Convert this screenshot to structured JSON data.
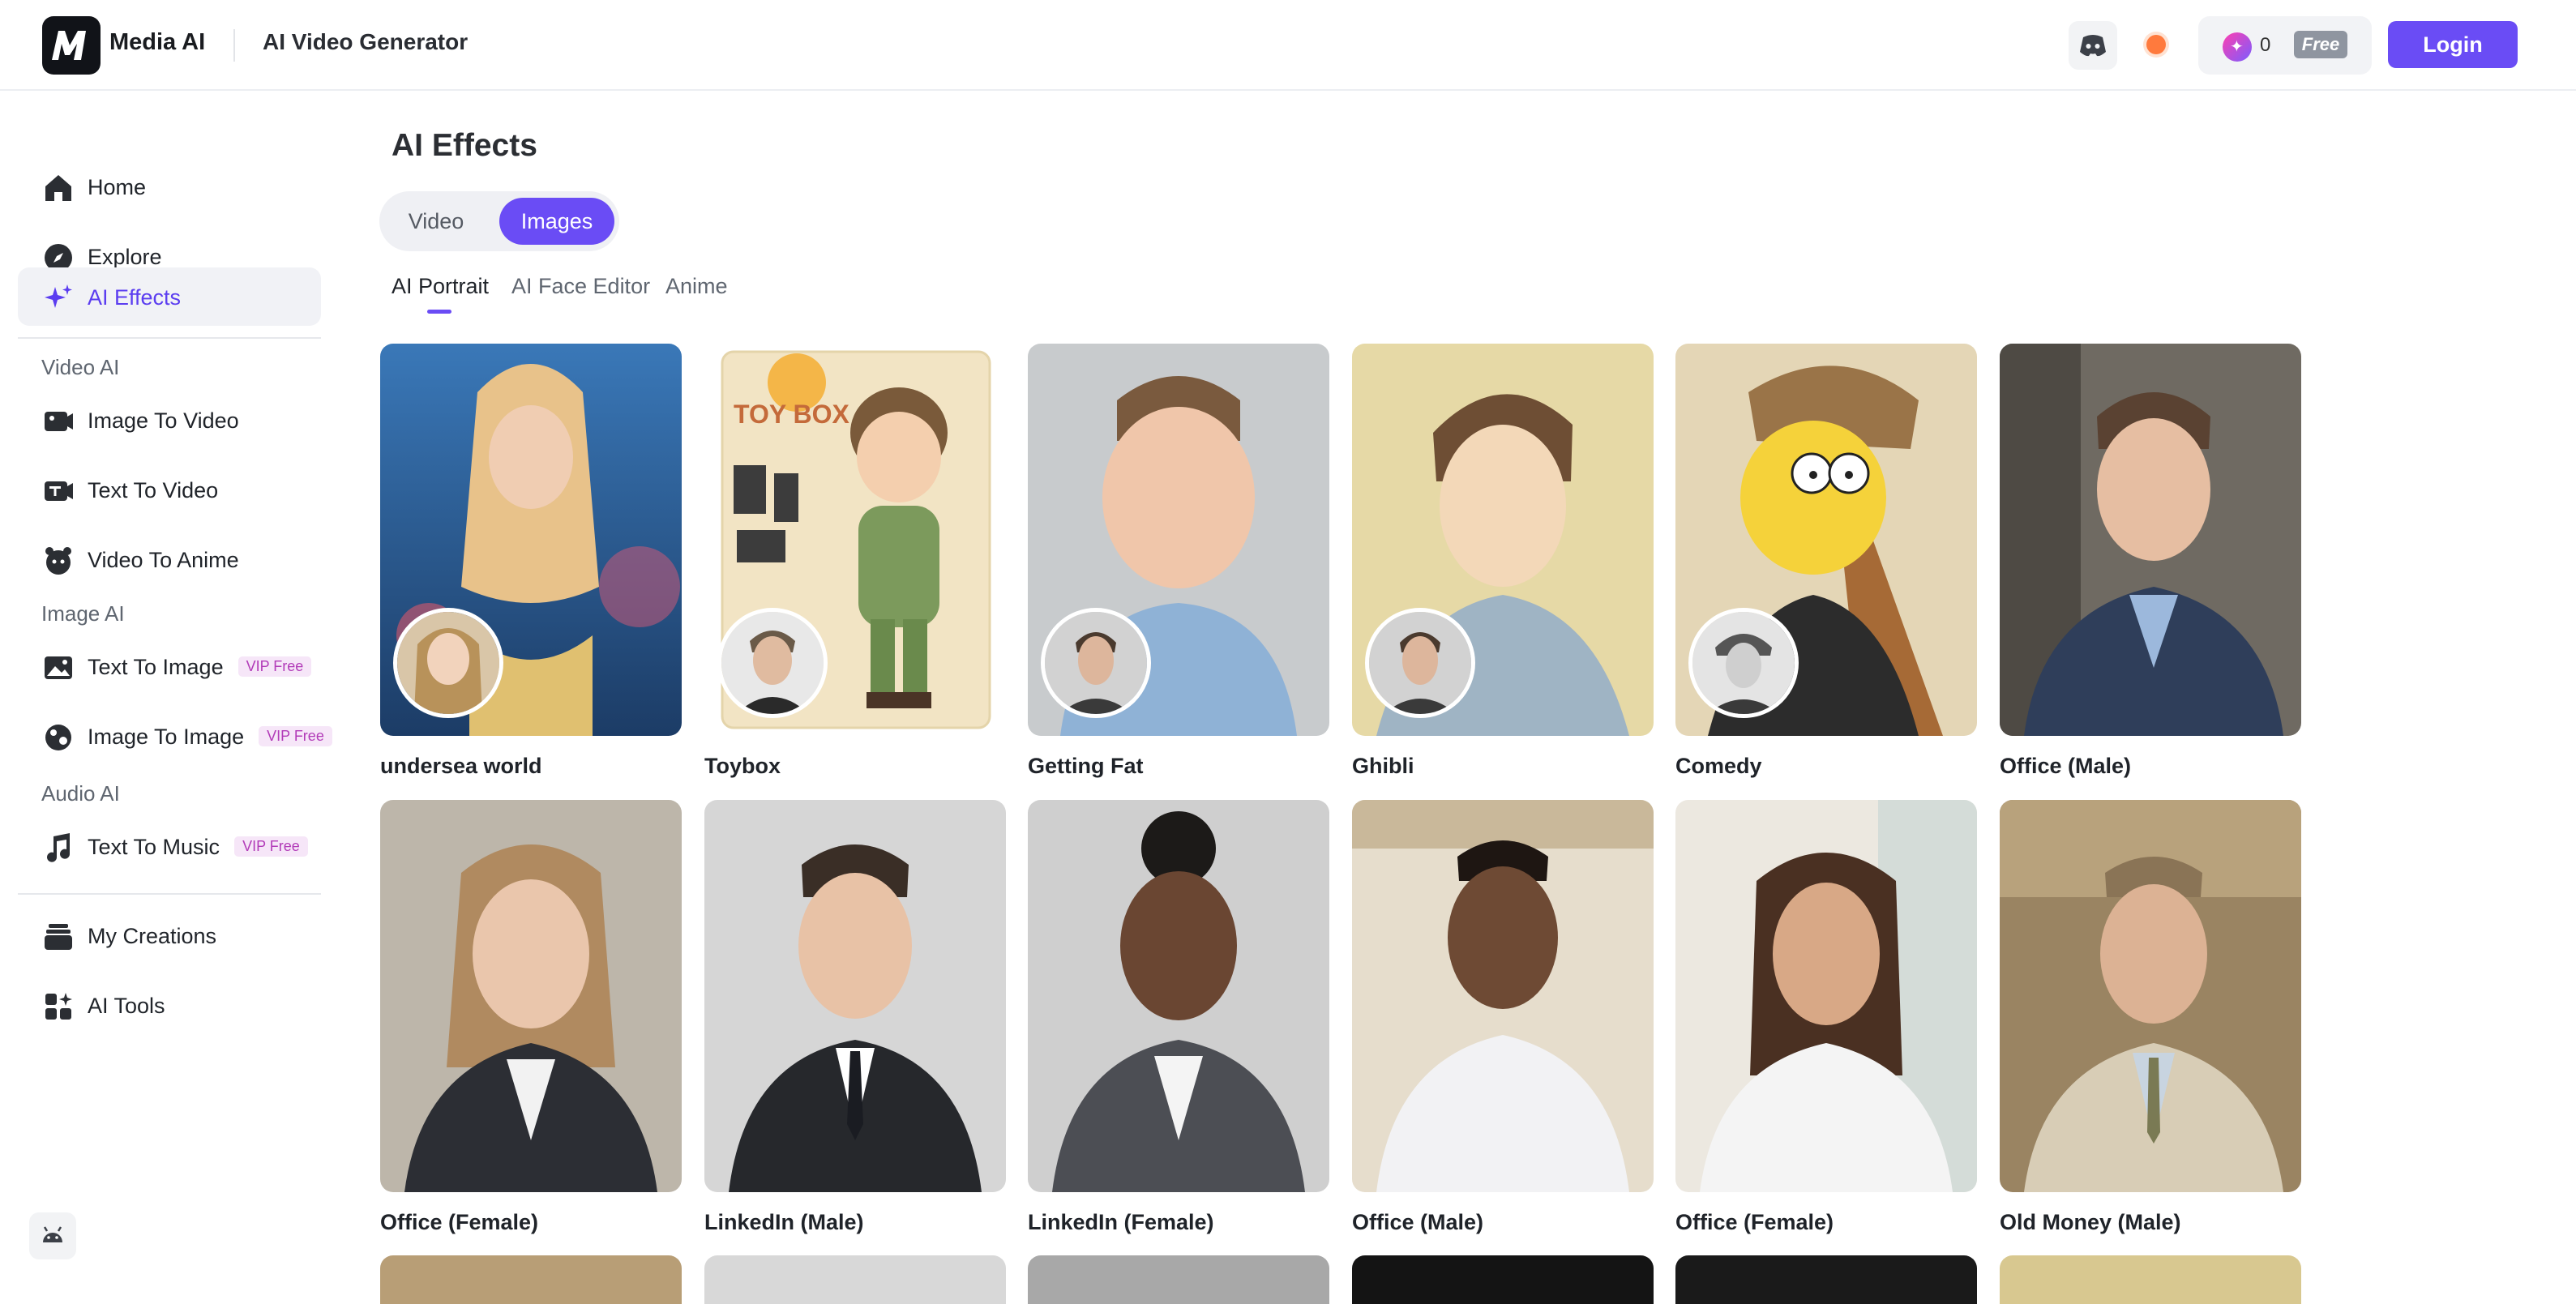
{
  "header": {
    "brand": "Media AI",
    "title": "AI Video Generator",
    "credits": "0",
    "plan_badge": "Free",
    "login_label": "Login"
  },
  "sidebar": {
    "top_items": [
      {
        "label": "Home",
        "icon": "home-icon"
      },
      {
        "label": "Explore",
        "icon": "compass-icon"
      },
      {
        "label": "AI Effects",
        "icon": "sparkle-icon",
        "active": true
      }
    ],
    "sections": [
      {
        "title": "Video AI",
        "items": [
          {
            "label": "Image To Video",
            "icon": "image-video-icon"
          },
          {
            "label": "Text To Video",
            "icon": "text-video-icon"
          },
          {
            "label": "Video To Anime",
            "icon": "anime-icon"
          }
        ]
      },
      {
        "title": "Image AI",
        "items": [
          {
            "label": "Text To Image",
            "icon": "text-image-icon",
            "badge": "VIP Free"
          },
          {
            "label": "Image To Image",
            "icon": "image-image-icon",
            "badge": "VIP Free"
          }
        ]
      },
      {
        "title": "Audio AI",
        "items": [
          {
            "label": "Text To Music",
            "icon": "music-icon",
            "badge": "VIP Free"
          }
        ]
      }
    ],
    "bottom_items": [
      {
        "label": "My Creations",
        "icon": "creations-icon"
      },
      {
        "label": "AI Tools",
        "icon": "tools-icon"
      }
    ]
  },
  "main": {
    "title": "AI Effects",
    "segments": [
      "Video",
      "Images"
    ],
    "active_segment": "Images",
    "tabs": [
      "AI Portrait",
      "AI Face Editor",
      "Anime"
    ],
    "active_tab": "AI Portrait",
    "cards": [
      {
        "label": "undersea world"
      },
      {
        "label": "Toybox"
      },
      {
        "label": "Getting Fat"
      },
      {
        "label": "Ghibli"
      },
      {
        "label": "Comedy"
      },
      {
        "label": "Office (Male)"
      },
      {
        "label": "Office (Female)"
      },
      {
        "label": "LinkedIn (Male)"
      },
      {
        "label": "LinkedIn (Female)"
      },
      {
        "label": "Office (Male)"
      },
      {
        "label": "Office (Female)"
      },
      {
        "label": "Old Money (Male)"
      }
    ]
  },
  "colors": {
    "accent": "#6a4cf5",
    "vip_badge_bg": "#f6e6f8",
    "vip_badge_text": "#b23bb8",
    "status_dot": "#ff7a3d"
  }
}
